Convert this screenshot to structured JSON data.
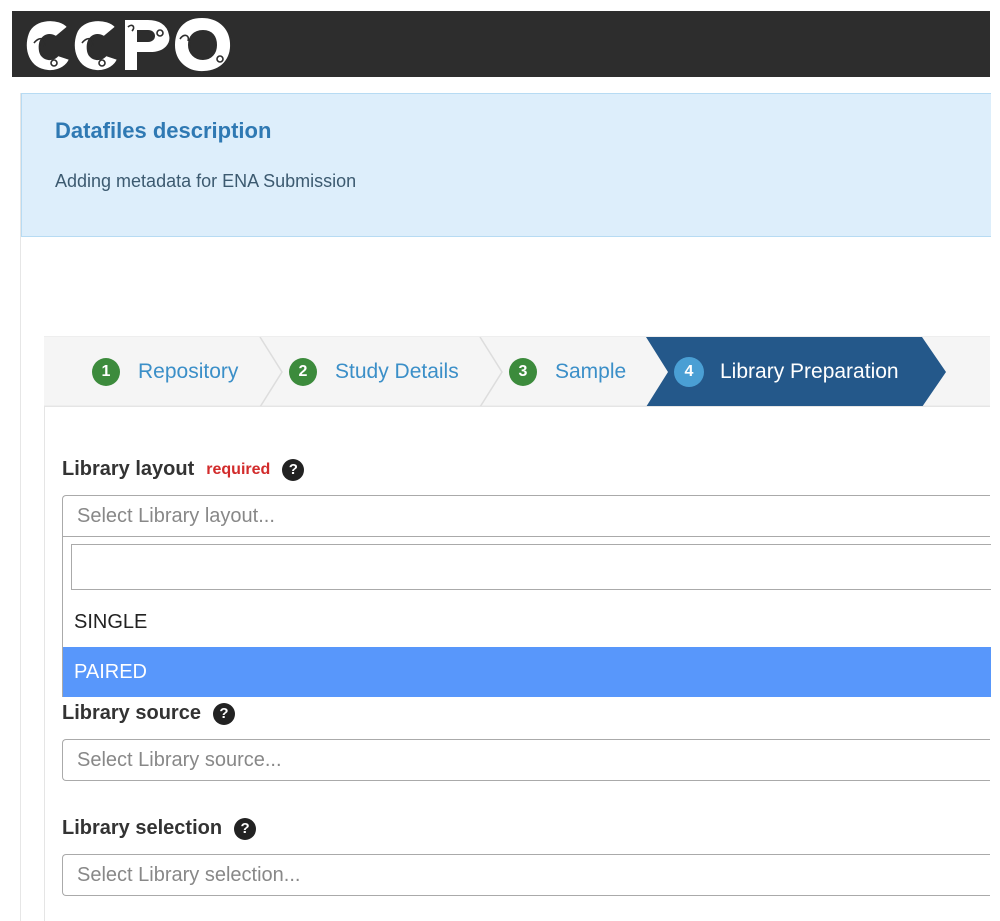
{
  "header": {
    "logo_text": "COPO"
  },
  "callout": {
    "title": "Datafiles description",
    "text": "Adding metadata for ENA Submission"
  },
  "wizard": {
    "steps": [
      {
        "number": "1",
        "label": "Repository"
      },
      {
        "number": "2",
        "label": "Study Details"
      },
      {
        "number": "3",
        "label": "Sample"
      },
      {
        "number": "4",
        "label": "Library Preparation"
      }
    ],
    "active_index": 3
  },
  "form": {
    "library_layout": {
      "label": "Library layout",
      "required_label": "required",
      "placeholder": "Select Library layout...",
      "search_value": "",
      "options": [
        "SINGLE",
        "PAIRED"
      ],
      "highlighted_option": "PAIRED"
    },
    "library_source": {
      "label": "Library source",
      "placeholder": "Select Library source..."
    },
    "library_selection": {
      "label": "Library selection",
      "placeholder": "Select Library selection..."
    },
    "help_icon_glyph": "?"
  },
  "colors": {
    "header_bg": "#2d2d2d",
    "callout_bg": "#ddeefb",
    "callout_title": "#2f79b3",
    "step_badge": "#3c8b3c",
    "step_active_bg": "#24588a",
    "required": "#d22b2b",
    "option_highlight": "#5897fb"
  },
  "icons": [
    "copo-logo",
    "question-circle-icon"
  ]
}
